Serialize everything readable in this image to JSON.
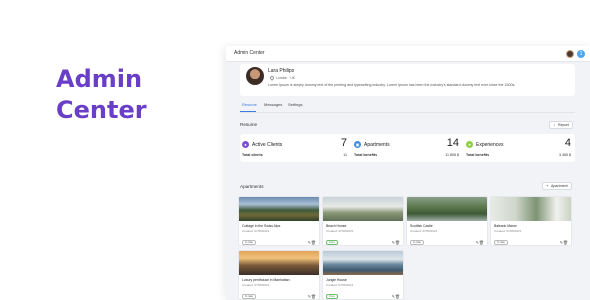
{
  "hero": {
    "line1": "Admin",
    "line2": "Center"
  },
  "topbar": {
    "title": "Admin Center",
    "notification_count": "1"
  },
  "profile": {
    "name": "Lara Philips",
    "location": "London · UK",
    "bio": "Lorem Ipsum is simply dummy text of the printing and typesetting industry. Lorem Ipsum has been the industry's standard dummy text ever since the 1500s."
  },
  "tabs": [
    {
      "label": "Resume",
      "active": true
    },
    {
      "label": "Messages",
      "active": false
    },
    {
      "label": "Settings",
      "active": false
    }
  ],
  "resume": {
    "title": "Resume",
    "report_button": "Report",
    "stats": [
      {
        "label": "Active Clients",
        "value": "7",
        "sub_label": "Total clients",
        "sub_value": "11",
        "icon": "person-icon",
        "color": "#7b4fd6"
      },
      {
        "label": "Apartments",
        "value": "14",
        "sub_label": "Total benefits",
        "sub_value": "11 806 $",
        "icon": "building-icon",
        "color": "#3a8de0"
      },
      {
        "label": "Experiences",
        "value": "4",
        "sub_label": "Total benefits",
        "sub_value": "3 465 $",
        "icon": "star-icon",
        "color": "#8bcf3a"
      }
    ]
  },
  "apartments": {
    "title": "Apartments",
    "add_button": "Apartment",
    "items": [
      {
        "name": "Cottage in the Swiss Alps",
        "date": "Created: 07/08/2021",
        "status": "In rate",
        "free": false,
        "scene": "alps"
      },
      {
        "name": "Beach House",
        "date": "Created: 07/08/2021",
        "status": "Free",
        "free": true,
        "scene": "beach"
      },
      {
        "name": "Scottish Castle",
        "date": "Created: 07/08/2021",
        "status": "In rate",
        "free": false,
        "scene": "castle"
      },
      {
        "name": "Balearic Manor",
        "date": "Created: 07/08/2021",
        "status": "In rate",
        "free": false,
        "scene": "manor"
      },
      {
        "name": "Luxury penthouse in Manhattan",
        "date": "Created: 07/08/2021",
        "status": "In rate",
        "free": false,
        "scene": "city"
      },
      {
        "name": "Jungle House",
        "date": "Created: 07/08/2021",
        "status": "Free",
        "free": true,
        "scene": "jungle"
      }
    ]
  }
}
